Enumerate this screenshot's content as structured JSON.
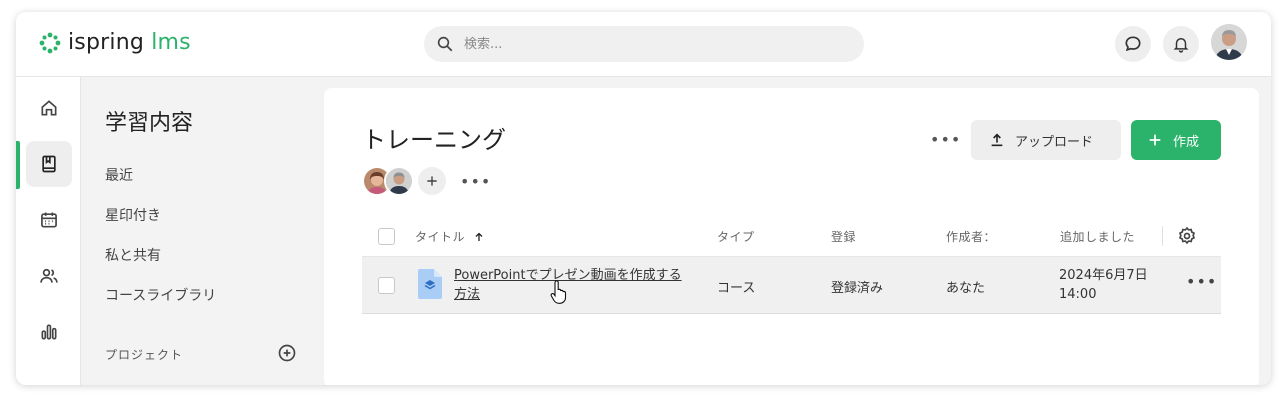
{
  "header": {
    "logo_part1": "ispring",
    "logo_part2": "lms",
    "search_placeholder": "検索...",
    "colors": {
      "brand_green": "#2bb36b"
    }
  },
  "rail": {
    "items": [
      {
        "icon": "home-icon",
        "active": false
      },
      {
        "icon": "book-icon",
        "active": true
      },
      {
        "icon": "calendar-icon",
        "active": false
      },
      {
        "icon": "users-icon",
        "active": false
      },
      {
        "icon": "bar-chart-icon",
        "active": false
      }
    ]
  },
  "sidebar": {
    "title": "学習内容",
    "links": [
      "最近",
      "星印付き",
      "私と共有",
      "コースライブラリ"
    ],
    "section_label": "プロジェクト"
  },
  "main": {
    "title": "トレーニング",
    "upload_label": "アップロード",
    "create_label": "作成",
    "columns": {
      "title": "タイトル",
      "type": "タイプ",
      "enrollment": "登録",
      "author": "作成者：",
      "added": "追加しました"
    },
    "rows": [
      {
        "title": "PowerPointでプレゼン動画を作成する方法",
        "type": "コース",
        "enrollment": "登録済み",
        "author": "あなた",
        "added": "2024年6月7日 14:00"
      }
    ]
  }
}
